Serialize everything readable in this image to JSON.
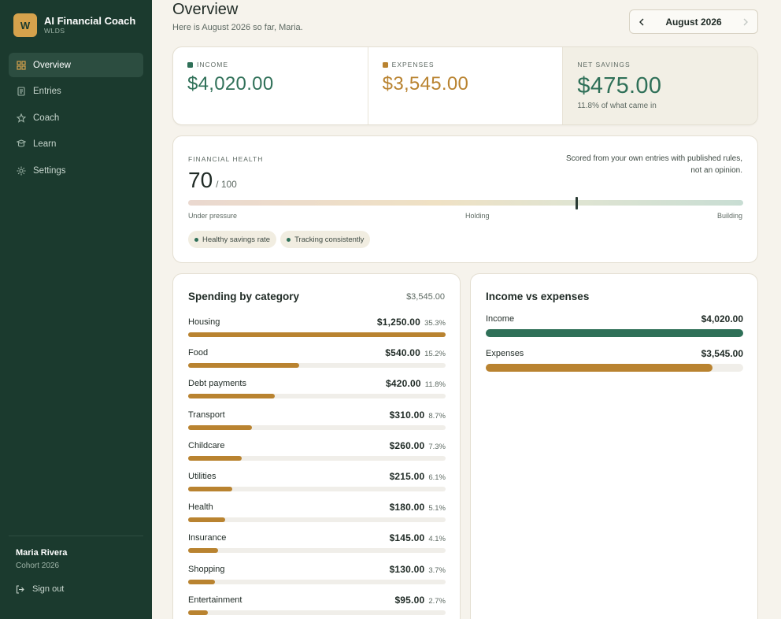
{
  "app": {
    "title": "AI Financial Coach",
    "subtitle": "WLDS",
    "logo_letter": "W"
  },
  "nav": [
    {
      "label": "Overview",
      "icon": "grid-icon",
      "active": true
    },
    {
      "label": "Entries",
      "icon": "list-icon",
      "active": false
    },
    {
      "label": "Coach",
      "icon": "star-icon",
      "active": false
    },
    {
      "label": "Learn",
      "icon": "book-icon",
      "active": false
    },
    {
      "label": "Settings",
      "icon": "gear-icon",
      "active": false
    }
  ],
  "user": {
    "name": "Maria Rivera",
    "cohort": "Cohort 2026",
    "signout_label": "Sign out"
  },
  "header": {
    "title": "Overview",
    "subtitle": "Here is August 2026 so far, Maria.",
    "month": "August 2026"
  },
  "summary": {
    "income": {
      "label": "INCOME",
      "value": "$4,020.00",
      "color": "#2f7058"
    },
    "expenses": {
      "label": "EXPENSES",
      "value": "$3,545.00",
      "color": "#b98330"
    },
    "net": {
      "label": "NET SAVINGS",
      "value": "$475.00",
      "note": "11.8% of what came in",
      "color": "#2f7058"
    }
  },
  "health": {
    "label": "FINANCIAL HEALTH",
    "score": "70",
    "max": "/ 100",
    "score_fraction": 0.7,
    "note": "Scored from your own entries with published rules, not an opinion.",
    "scale": [
      "Under pressure",
      "Holding",
      "Building"
    ],
    "chips": [
      "Healthy savings rate",
      "Tracking consistently"
    ]
  },
  "spending": {
    "title": "Spending by category",
    "total": "$3,545.00",
    "bar_color": "#b98330",
    "categories": [
      {
        "name": "Housing",
        "amount": "$1,250.00",
        "pct": "35.3%",
        "share": 1.0
      },
      {
        "name": "Food",
        "amount": "$540.00",
        "pct": "15.2%",
        "share": 0.432
      },
      {
        "name": "Debt payments",
        "amount": "$420.00",
        "pct": "11.8%",
        "share": 0.336
      },
      {
        "name": "Transport",
        "amount": "$310.00",
        "pct": "8.7%",
        "share": 0.248
      },
      {
        "name": "Childcare",
        "amount": "$260.00",
        "pct": "7.3%",
        "share": 0.208
      },
      {
        "name": "Utilities",
        "amount": "$215.00",
        "pct": "6.1%",
        "share": 0.172
      },
      {
        "name": "Health",
        "amount": "$180.00",
        "pct": "5.1%",
        "share": 0.144
      },
      {
        "name": "Insurance",
        "amount": "$145.00",
        "pct": "4.1%",
        "share": 0.116
      },
      {
        "name": "Shopping",
        "amount": "$130.00",
        "pct": "3.7%",
        "share": 0.104
      },
      {
        "name": "Entertainment",
        "amount": "$95.00",
        "pct": "2.7%",
        "share": 0.076
      }
    ]
  },
  "income_vs_expenses": {
    "title": "Income vs expenses",
    "rows": [
      {
        "name": "Income",
        "amount": "$4,020.00",
        "share": 1.0,
        "color": "#2f7058"
      },
      {
        "name": "Expenses",
        "amount": "$3,545.00",
        "share": 0.882,
        "color": "#b98330"
      }
    ]
  }
}
